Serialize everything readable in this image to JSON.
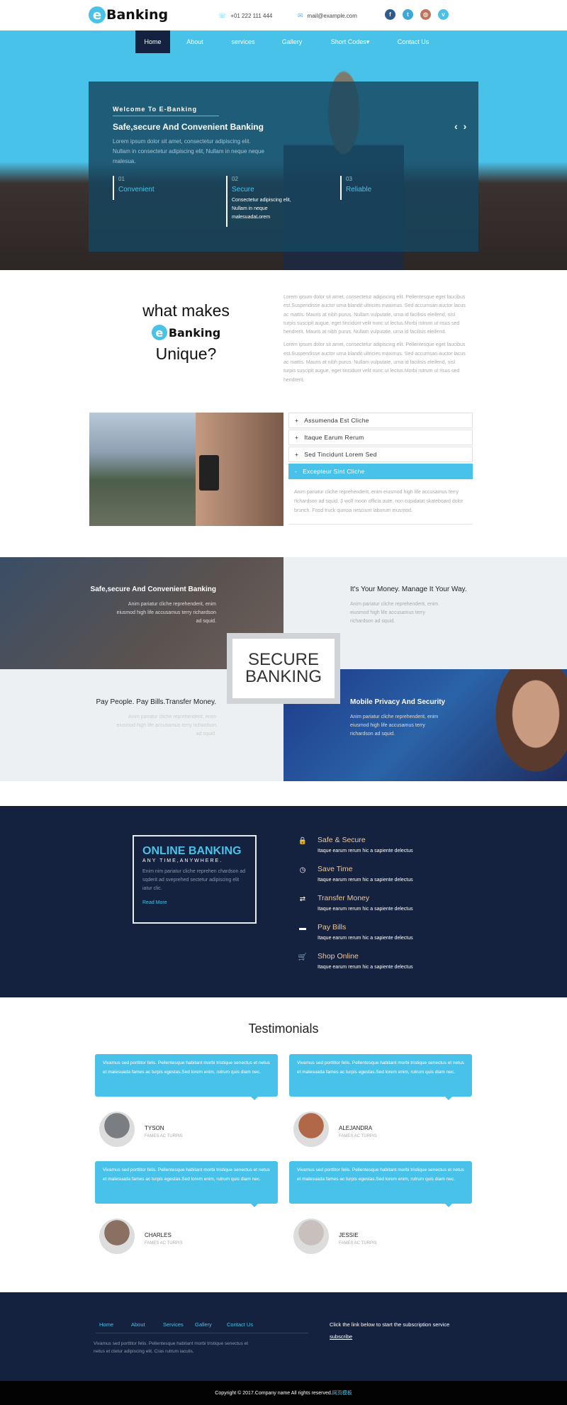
{
  "header": {
    "logo_letter": "e",
    "logo_text": "Banking",
    "phone": "+01 222 111 444",
    "email": "mail@example.com",
    "social": [
      {
        "icon": "facebook-icon",
        "glyph": "f",
        "color": "#2f5b8c"
      },
      {
        "icon": "twitter-icon",
        "glyph": "t",
        "color": "#3aa8d8"
      },
      {
        "icon": "dribbble-icon",
        "glyph": "◎",
        "color": "#c0745e"
      },
      {
        "icon": "vimeo-icon",
        "glyph": "v",
        "color": "#49c2ea"
      }
    ]
  },
  "nav": {
    "items": [
      "Home",
      "About",
      "services",
      "Gallery",
      "Short Codes▾",
      "Contact Us"
    ],
    "active": "Home"
  },
  "hero": {
    "welcome": "Welcome To E-Banking",
    "title": "Safe,secure And Convenient Banking",
    "text": "Lorem ipsum dolor sit amet, consectetur adipiscing elit. Nullam in consectetur adipiscing elit, Nullam in neque neque malesua.",
    "features": [
      {
        "num": "01",
        "title": "Convenient",
        "desc": ""
      },
      {
        "num": "02",
        "title": "Secure",
        "desc": "Consectetur adipiscing elit, Nullam in neque malesuadaLorem"
      },
      {
        "num": "03",
        "title": "Reliable",
        "desc": ""
      }
    ],
    "prev": "‹",
    "next": "›"
  },
  "unique": {
    "line1": "what makes",
    "logo_letter": "e",
    "logo_text": "Banking",
    "line3": "Unique?",
    "paragraphs": [
      "Lorem ipsum dolor sit amet, consectetur adipiscing elit. Pellentesque eget faucibus est.Suspendisse auctor urna blandit ultricies maximus. Sed accumsan auctor lacus ac mattis. Mauris at nibh purus. Nullam vulputate, urna id facilisis eleifend, nisl turpis suscipit augue, eget tincidunt velit nunc ut lectus.Morbi rutrum ut risus sed hendrerit. Mauris at nibh purus. Nullam vulputate, urna id facilisis eleifend.",
      "Lorem ipsum dolor sit amet, consectetur adipiscing elit. Pellentesque eget faucibus est.Suspendisse auctor urna blandit ultricies maximus. Sed accumsan auctor lacus ac mattis. Mauris at nibh purus. Nullam vulputate, urna id facilisis eleifend, nisl turpis suscipit augue, eget tincidunt velit nunc ut lectus.Morbi rutrum ut risus sed hendrerit."
    ]
  },
  "accordion": {
    "items": [
      {
        "sign": "+",
        "label": "Assumenda Est Cliche"
      },
      {
        "sign": "+",
        "label": "Itaque Earum Rerum"
      },
      {
        "sign": "+",
        "label": "Sed Tincidunt Lorem Sed"
      },
      {
        "sign": "-",
        "label": "Excepteur Sint Cliche"
      }
    ],
    "open_body": "Anim pariatur cliche reprehenderit, enim eiusmod high life accusamus terry richardson ad squid. 3 wolf moon officia aute, non cupidatat skateboard dolor brunch. Food truck quinoa nesciunt laborum eiusmod."
  },
  "grid": {
    "center_line1": "SECURE",
    "center_line2": "BANKING",
    "cells": [
      {
        "title": "Safe,secure And Convenient Banking",
        "text": "Anim pariatur cliche reprehenderit, enim eiusmod high life accusamus terry richardson ad squid."
      },
      {
        "title": "It's Your Money. Manage It Your Way.",
        "text": "Anim pariatur cliche reprehenderit, enim eiusmod high life accusamus terry richardson ad squid."
      },
      {
        "title": "Pay People. Pay Bills.Transfer Money.",
        "text": "Anim pariatur cliche reprehenderit, enim eiusmod high life accusamus terry richardson ad squid."
      },
      {
        "title": "Mobile Privacy And Security",
        "text": "Anim pariatur cliche reprehenderit, enim eiusmod high life accusamus terry richardson ad squid."
      }
    ]
  },
  "online": {
    "title": "ONLINE BANKING",
    "subtitle": "ANY TIME,ANYWHERE.",
    "text": "Enim nim pariatur cliche reprehen chardson ad sqderit ad sveprehed sectetur adipiscing elit iatur clic.",
    "link": "Read More",
    "services": [
      {
        "icon": "lock-icon",
        "glyph": "🔒",
        "title": "Safe & Secure",
        "desc": "Itaque earum rerum hic a sapiente delectus"
      },
      {
        "icon": "clock-icon",
        "glyph": "◷",
        "title": "Save Time",
        "desc": "Itaque earum rerum hic a sapiente delectus"
      },
      {
        "icon": "transfer-icon",
        "glyph": "⇄",
        "title": "Transfer Money",
        "desc": "Itaque earum rerum hic a sapiente delectus"
      },
      {
        "icon": "credit-card-icon",
        "glyph": "▬",
        "title": "Pay Bills",
        "desc": "Itaque earum rerum hic a sapiente delectus"
      },
      {
        "icon": "cart-icon",
        "glyph": "🛒",
        "title": "Shop Online",
        "desc": "Itaque earum rerum hic a sapiente delectus"
      }
    ]
  },
  "testimonials": {
    "title": "Testimonials",
    "items": [
      {
        "text": "Vivamus sed porttitor felis. Pellentesque habitant morbi tristique senectus et netus et malesuada fames ac turpis egestas.Sed lorem enim, rutrum quis diam nec.",
        "name": "TYSON",
        "role": "FAMES AC TURPIS",
        "avatar": "#7a7d82"
      },
      {
        "text": "Vivamus sed porttitor felis. Pellentesque habitant morbi tristique senectus et netus et malesuada fames ac turpis egestas.Sed lorem enim, rutrum quis diam nec.",
        "name": "ALEJANDRA",
        "role": "FAMES AC TURPIS",
        "avatar": "#b06848"
      },
      {
        "text": "Vivamus sed porttitor felis. Pellentesque habitant morbi tristique senectus et netus et malesuada fames ac turpis egestas.Sed lorem enim, rutrum quis diam nec.",
        "name": "CHARLES",
        "role": "FAMES AC TURPIS",
        "avatar": "#8a7060"
      },
      {
        "text": "Vivamus sed porttitor felis. Pellentesque habitant morbi tristique senectus et netus et malesuada fames ac turpis egestas.Sed lorem enim, rutrum quis diam nec.",
        "name": "JESSIE",
        "role": "FAMES AC TURPIS",
        "avatar": "#c8c0bc"
      }
    ]
  },
  "footer": {
    "links": [
      "Home",
      "About",
      "Services",
      "Gallery",
      "Contact Us"
    ],
    "text": "Vivamus sed porttitor felis. Pellentesque habitant morbi tristique senectus et netus et ctetur adipiscing elit. Cras rutrum iaculis.",
    "subscribe_text": "Click the link below to start the subscription service",
    "subscribe_link": "subscribe",
    "copyright": "Copyright © 2017.Company name All rights reserved.",
    "copyright_link": "网页模板"
  },
  "colors": {
    "accent": "#49c2ea",
    "navy": "#14223f"
  }
}
